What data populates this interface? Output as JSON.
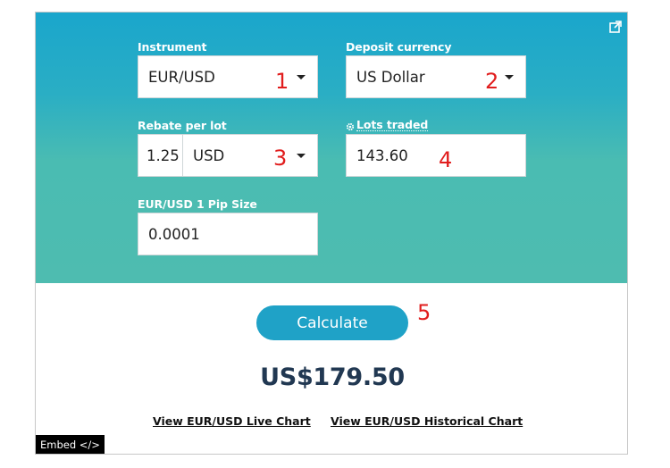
{
  "form": {
    "instrument": {
      "label": "Instrument",
      "value": "EUR/USD"
    },
    "deposit_currency": {
      "label": "Deposit currency",
      "value": "US Dollar"
    },
    "rebate": {
      "label": "Rebate per lot",
      "amount": "1.25",
      "currency": "USD"
    },
    "lots": {
      "label": "Lots traded",
      "value": "143.60"
    },
    "pip": {
      "label": "EUR/USD 1 Pip Size",
      "value": "0.0001"
    }
  },
  "annotations": [
    "1",
    "2",
    "3",
    "4",
    "5"
  ],
  "calculate_label": "Calculate",
  "result": "US$179.50",
  "links": {
    "live_chart": "View EUR/USD Live Chart",
    "historical_chart": "View EUR/USD Historical Chart"
  },
  "embed_label": "Embed </>",
  "colors": {
    "gradient_top": "#1aa6cc",
    "gradient_bottom": "#4ebcb0",
    "button": "#1fa2c7",
    "result_text": "#213852",
    "annotation": "#e11d1d"
  },
  "icons": {
    "external": "external-link-icon",
    "gear": "gear-icon",
    "dropdown": "chevron-down-icon"
  }
}
